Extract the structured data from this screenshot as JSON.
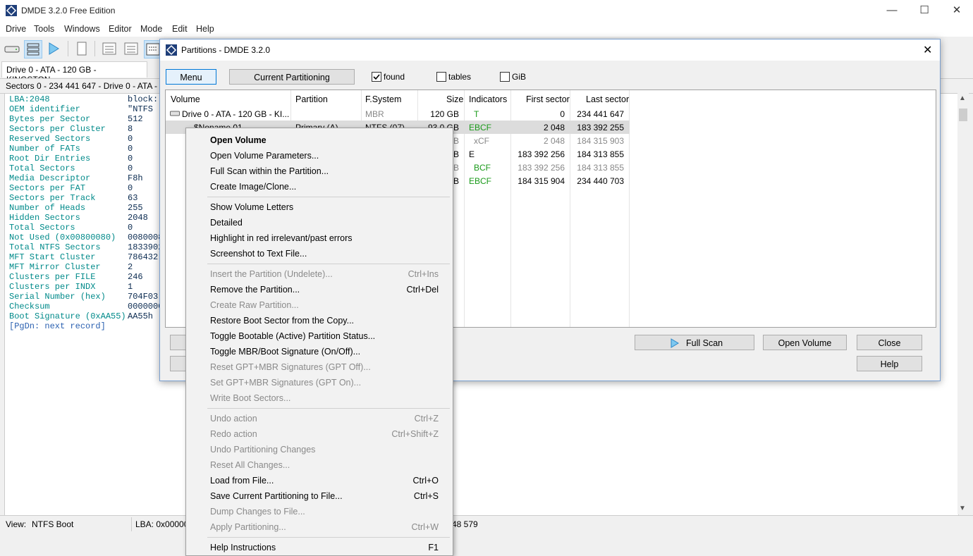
{
  "app": {
    "title": "DMDE 3.2.0 Free Edition",
    "menu": [
      "Drive",
      "Tools",
      "Windows",
      "Editor",
      "Mode",
      "Edit",
      "Help"
    ],
    "drive_tab": "Drive 0 - ATA - 120 GB - KINGSTON...",
    "sectors_bar": "Sectors 0 - 234 441 647 - Drive 0 - ATA - 12",
    "lba": "LBA:2048",
    "block": "block: 1",
    "records": [
      {
        "key": "OEM identifier",
        "value": "\"NTFS"
      },
      {
        "key": "Bytes per Sector",
        "value": "512"
      },
      {
        "key": "Sectors per Cluster",
        "value": "8"
      },
      {
        "key": "Reserved Sectors",
        "value": "0"
      },
      {
        "key": "Number of FATs",
        "value": "0"
      },
      {
        "key": "Root Dir Entries",
        "value": "0"
      },
      {
        "key": "Total Sectors",
        "value": "0"
      },
      {
        "key": "Media Descriptor",
        "value": "F8h"
      },
      {
        "key": "Sectors per FAT",
        "value": "0"
      },
      {
        "key": "Sectors per Track",
        "value": "63"
      },
      {
        "key": "Number of Heads",
        "value": "255"
      },
      {
        "key": "Hidden Sectors",
        "value": "2048"
      },
      {
        "key": "Total Sectors",
        "value": "0"
      },
      {
        "key": "Not Used (0x00800080)",
        "value": "0080008"
      },
      {
        "key": "Total NTFS Sectors",
        "value": "1833902"
      },
      {
        "key": "MFT Start Cluster",
        "value": "786432"
      },
      {
        "key": "MFT Mirror Cluster",
        "value": "2"
      },
      {
        "key": "Clusters per FILE",
        "value": "246"
      },
      {
        "key": "Clusters per INDX",
        "value": "1"
      },
      {
        "key": "Serial Number (hex)",
        "value": "704F03"
      },
      {
        "key": "Checksum",
        "value": "0000000"
      },
      {
        "key": "Boot Signature (0xAA55)",
        "value": "AA55h"
      }
    ],
    "next_record": "[PgDn: next record]",
    "status": {
      "view_label": "View:",
      "view_value": "NTFS Boot",
      "lba": "LBA: 0x000008",
      "tail": "48 579"
    }
  },
  "dialog": {
    "title": "Partitions - DMDE 3.2.0",
    "menu_button": "Menu",
    "current_partitioning_button": "Current Partitioning",
    "checkboxes": [
      {
        "label": "found",
        "checked": true
      },
      {
        "label": "tables",
        "checked": false
      },
      {
        "label": "GiB",
        "checked": false
      }
    ],
    "columns": [
      "Volume",
      "Partition",
      "F.System",
      "Size",
      "Indicators",
      "First sector",
      "Last sector"
    ],
    "rows": [
      {
        "volume": "Drive 0 - ATA - 120 GB - KI...",
        "partition": "",
        "fs": "MBR",
        "size": "120 GB",
        "ind": "T",
        "first": "0",
        "last": "234 441 647"
      },
      {
        "volume": "$Noname 01",
        "partition": "Primary (A)",
        "fs": "NTFS (07)",
        "size": "93.0 GB",
        "ind": "EBCF",
        "first": "2 048",
        "last": "183 392 255"
      },
      {
        "volume": "",
        "partition": "",
        "fs": "",
        "size": "GB",
        "ind": "xCF",
        "first": "2 048",
        "last": "184 315 903"
      },
      {
        "volume": "",
        "partition": "",
        "fs": "",
        "size": "MB",
        "ind": "E",
        "first": "183 392 256",
        "last": "184 313 855"
      },
      {
        "volume": "",
        "partition": "",
        "fs": "",
        "size": "MB",
        "ind": "BCF",
        "first": "183 392 256",
        "last": "184 313 855"
      },
      {
        "volume": "",
        "partition": "",
        "fs": "",
        "size": "GB",
        "ind": "EBCF",
        "first": "184 315 904",
        "last": "234 440 703"
      }
    ],
    "full_scan_button": "Full Scan",
    "open_volume_button": "Open Volume",
    "close_button": "Close",
    "help_button": "Help"
  },
  "context_menu": {
    "groups": [
      [
        {
          "label": "Open Volume",
          "shortcut": "",
          "disabled": false,
          "bold": true
        },
        {
          "label": "Open Volume Parameters...",
          "shortcut": "",
          "disabled": false
        },
        {
          "label": "Full Scan within the Partition...",
          "shortcut": "",
          "disabled": false
        },
        {
          "label": "Create Image/Clone...",
          "shortcut": "",
          "disabled": false
        }
      ],
      [
        {
          "label": "Show Volume Letters",
          "shortcut": "",
          "disabled": false
        },
        {
          "label": "Detailed",
          "shortcut": "",
          "disabled": false
        },
        {
          "label": "Highlight in red irrelevant/past errors",
          "shortcut": "",
          "disabled": false
        },
        {
          "label": "Screenshot to Text File...",
          "shortcut": "",
          "disabled": false
        }
      ],
      [
        {
          "label": "Insert the Partition (Undelete)...",
          "shortcut": "Ctrl+Ins",
          "disabled": true
        },
        {
          "label": "Remove the Partition...",
          "shortcut": "Ctrl+Del",
          "disabled": false
        },
        {
          "label": "Create Raw Partition...",
          "shortcut": "",
          "disabled": true
        },
        {
          "label": "Restore Boot Sector from the Copy...",
          "shortcut": "",
          "disabled": false
        },
        {
          "label": "Toggle Bootable (Active) Partition Status...",
          "shortcut": "",
          "disabled": false
        },
        {
          "label": "Toggle MBR/Boot Signature (On/Off)...",
          "shortcut": "",
          "disabled": false
        },
        {
          "label": "Reset GPT+MBR Signatures (GPT Off)...",
          "shortcut": "",
          "disabled": true
        },
        {
          "label": "Set GPT+MBR Signatures (GPT On)...",
          "shortcut": "",
          "disabled": true
        },
        {
          "label": "Write Boot Sectors...",
          "shortcut": "",
          "disabled": true
        }
      ],
      [
        {
          "label": "Undo action",
          "shortcut": "Ctrl+Z",
          "disabled": true
        },
        {
          "label": "Redo action",
          "shortcut": "Ctrl+Shift+Z",
          "disabled": true
        },
        {
          "label": "Undo Partitioning Changes",
          "shortcut": "",
          "disabled": true
        },
        {
          "label": "Reset All Changes...",
          "shortcut": "",
          "disabled": true
        },
        {
          "label": "Load from File...",
          "shortcut": "Ctrl+O",
          "disabled": false
        },
        {
          "label": "Save Current Partitioning to File...",
          "shortcut": "Ctrl+S",
          "disabled": false
        },
        {
          "label": "Dump Changes to File...",
          "shortcut": "",
          "disabled": true
        },
        {
          "label": "Apply Partitioning...",
          "shortcut": "Ctrl+W",
          "disabled": true
        }
      ],
      [
        {
          "label": "Help Instructions",
          "shortcut": "F1",
          "disabled": false
        }
      ]
    ]
  },
  "icons": {
    "app": "dmde-logo-icon",
    "minimize": "minimize-icon",
    "maximize": "maximize-icon",
    "close": "close-icon",
    "drive": "hard-drive-icon",
    "play": "play-icon"
  },
  "colors": {
    "accent": "#0078d7",
    "record_key": "#008a8a",
    "indicator_green": "#1a9a1a"
  }
}
